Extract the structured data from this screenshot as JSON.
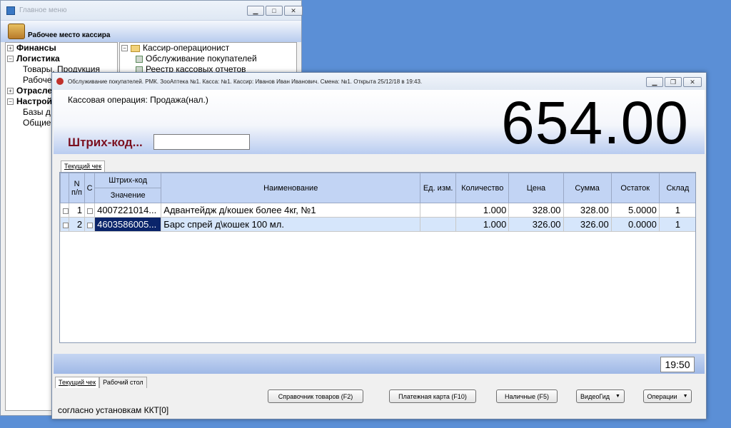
{
  "main_menu": {
    "title": "Главное меню",
    "header_title": "Рабочее место кассира",
    "tree": [
      {
        "label": "Финансы",
        "bold": true,
        "expander": "+"
      },
      {
        "label": "Логистика",
        "bold": true,
        "expander": "−"
      },
      {
        "label": "Товары, Продукция",
        "bold": false,
        "expander": ""
      },
      {
        "label": "Рабочее",
        "bold": false,
        "expander": ""
      },
      {
        "label": "Отрасле",
        "bold": true,
        "expander": "+"
      },
      {
        "label": "Настрой",
        "bold": true,
        "expander": "−"
      },
      {
        "label": "Базы д",
        "bold": false,
        "expander": ""
      },
      {
        "label": "Общие",
        "bold": false,
        "expander": ""
      }
    ],
    "right_tree": {
      "folder": "Кассир-операционист",
      "items": [
        "Обслуживание покупателей",
        "Реестр кассовых отчетов"
      ]
    }
  },
  "pos": {
    "title": "Обслуживание покупателей. РМК. ЗооАптека №1. Касса: №1. Кассир: Иванов Иван Иванович. Смена: №1. Открыта 25/12/18 в 19:43.",
    "operation": "Кассовая операция: Продажа(нал.)",
    "total": "654.00",
    "barcode_label": "Штрих-код...",
    "barcode_value": "",
    "top_tab": "Текущий чек",
    "columns": {
      "n": "N п/п",
      "c": "С",
      "barcode_group": "Штрих-код",
      "barcode_value": "Значение",
      "name": "Наименование",
      "unit": "Ед. изм.",
      "qty": "Количество",
      "price": "Цена",
      "sum": "Сумма",
      "stock": "Остаток",
      "warehouse": "Склад"
    },
    "rows": [
      {
        "n": "1",
        "barcode": "4007221014...",
        "name": "Адвантейдж д/кошек более 4кг, №1",
        "unit": "",
        "qty": "1.000",
        "price": "328.00",
        "sum": "328.00",
        "stock": "5.0000",
        "warehouse": "1"
      },
      {
        "n": "2",
        "barcode": "4603586005...",
        "name": "Барс спрей д\\кошек 100 мл.",
        "unit": "",
        "qty": "1.000",
        "price": "326.00",
        "sum": "326.00",
        "stock": "0.0000",
        "warehouse": "1"
      }
    ],
    "clock": "19:50",
    "bottom_tabs": [
      "Текущий чек",
      "Рабочий стол"
    ],
    "buttons": {
      "catalog": "Справочник товаров (F2)",
      "card": "Платежная карта (F10)",
      "cash": "Наличные (F5)",
      "video": "ВидеоГид",
      "operations": "Операции"
    },
    "footer": "согласно установкам ККТ[0]"
  },
  "colors": {
    "desktop": "#5b8fd6",
    "header_gradient_end": "#b9ccf0",
    "grid_header": "#c2d4f4",
    "selected_row": "#d6e6fb",
    "selected_cell": "#0a246a",
    "barcode_label": "#7a1020"
  }
}
